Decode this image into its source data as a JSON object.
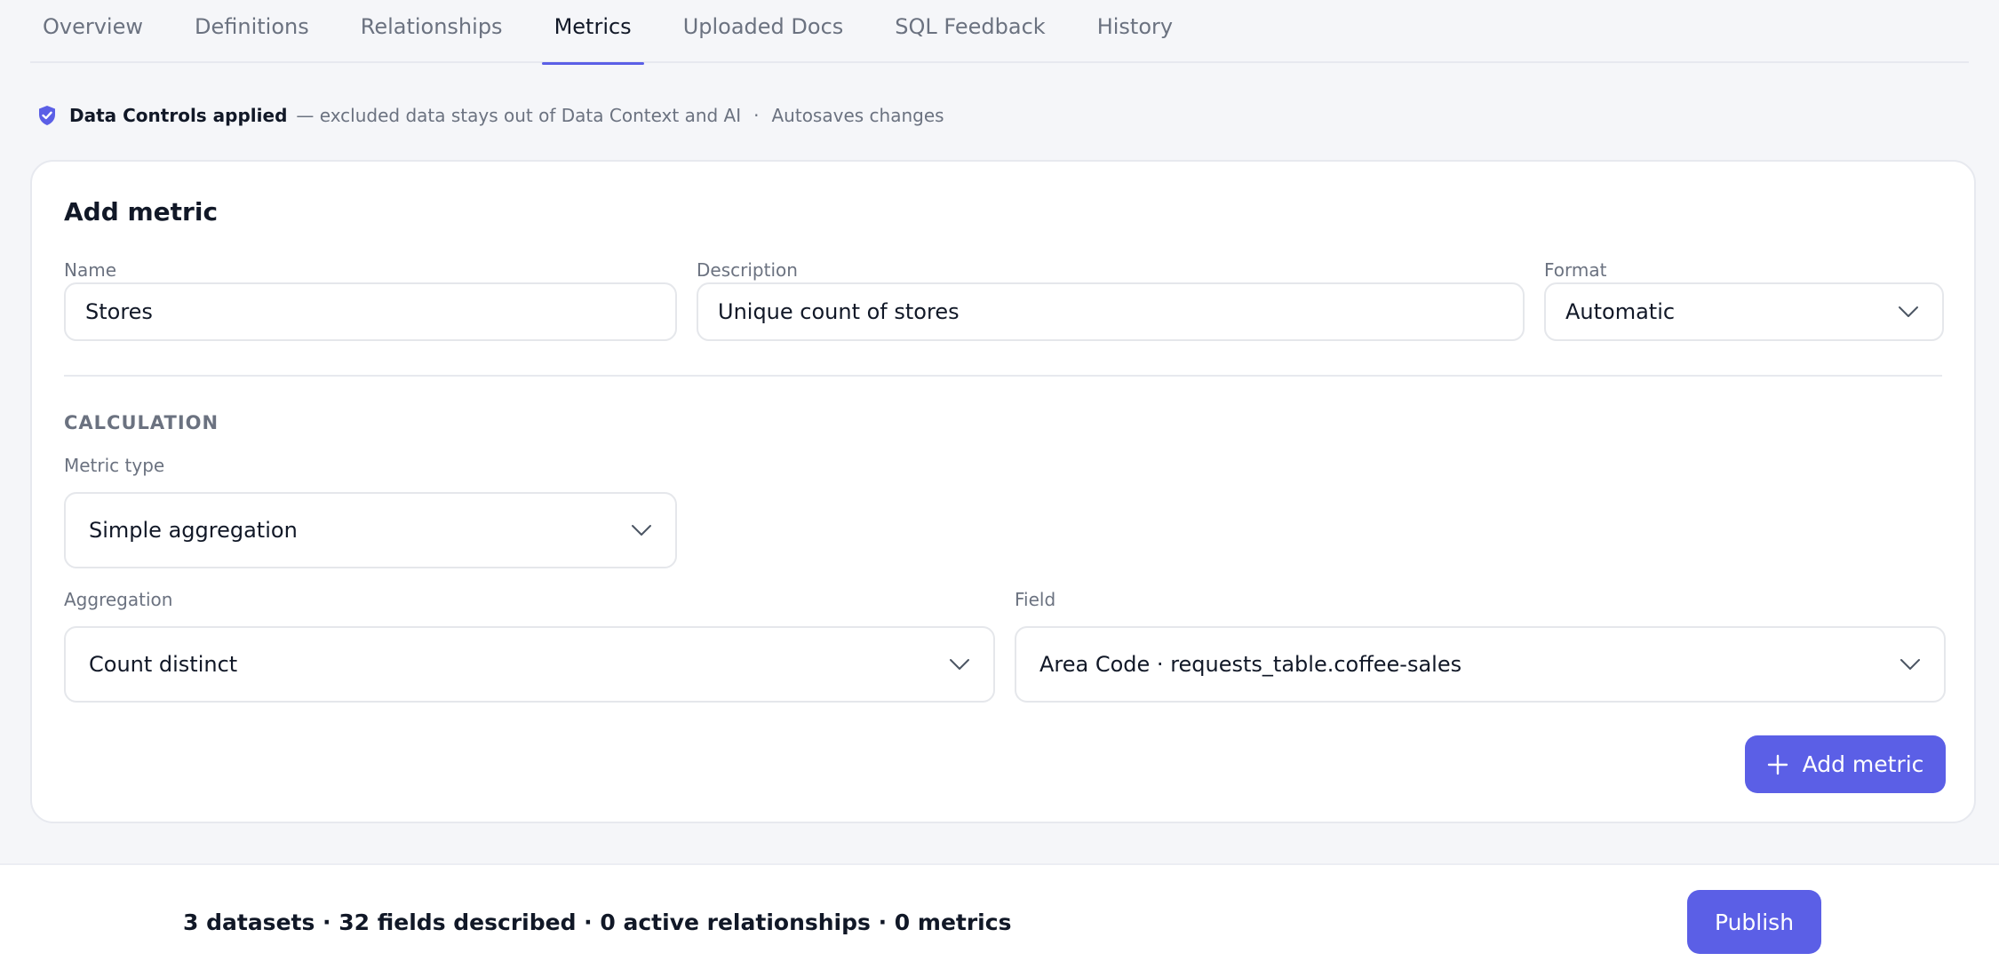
{
  "tabs": [
    {
      "label": "Overview"
    },
    {
      "label": "Definitions"
    },
    {
      "label": "Relationships"
    },
    {
      "label": "Metrics"
    },
    {
      "label": "Uploaded Docs"
    },
    {
      "label": "SQL Feedback"
    },
    {
      "label": "History"
    }
  ],
  "active_tab": "Metrics",
  "notice": {
    "title": "Data Controls applied",
    "detail": "— excluded data stays out of Data Context and AI",
    "separator": "·",
    "autosave": "Autosaves changes",
    "icon": "shield-check-icon"
  },
  "form": {
    "title": "Add metric",
    "name": {
      "label": "Name",
      "value": "Stores"
    },
    "description": {
      "label": "Description",
      "value": "Unique count of stores"
    },
    "format": {
      "label": "Format",
      "value": "Automatic"
    },
    "section_heading": "CALCULATION",
    "metric_type": {
      "label": "Metric type",
      "value": "Simple aggregation"
    },
    "aggregation": {
      "label": "Aggregation",
      "value": "Count distinct"
    },
    "field": {
      "label": "Field",
      "value": "Area Code · requests_table.coffee-sales"
    },
    "submit_label": "Add metric"
  },
  "footer": {
    "stats": "3 datasets · 32 fields described · 0 active relationships · 0 metrics",
    "publish_label": "Publish"
  },
  "colors": {
    "accent": "#5b5fe6",
    "background": "#f5f6f9",
    "text": "#111827",
    "muted": "#6b7280"
  }
}
